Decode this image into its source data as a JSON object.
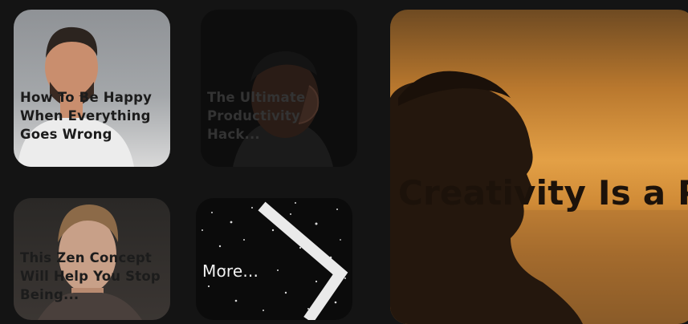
{
  "cards": [
    {
      "title": "How To Be Happy When Everything Goes Wrong"
    },
    {
      "title": "The Ultimate Productivity Hack..."
    },
    {
      "title": "This Zen Concept Will Help You Stop Being..."
    },
    {
      "title": "More..."
    }
  ],
  "featured": {
    "title": "Creativity Is a Process, Not an Event"
  },
  "icons": {
    "more_arrow": "chevron-right-icon"
  },
  "colors": {
    "background": "#141414",
    "title_text": "#1c1c1c",
    "more_text": "#f2f2f2"
  }
}
